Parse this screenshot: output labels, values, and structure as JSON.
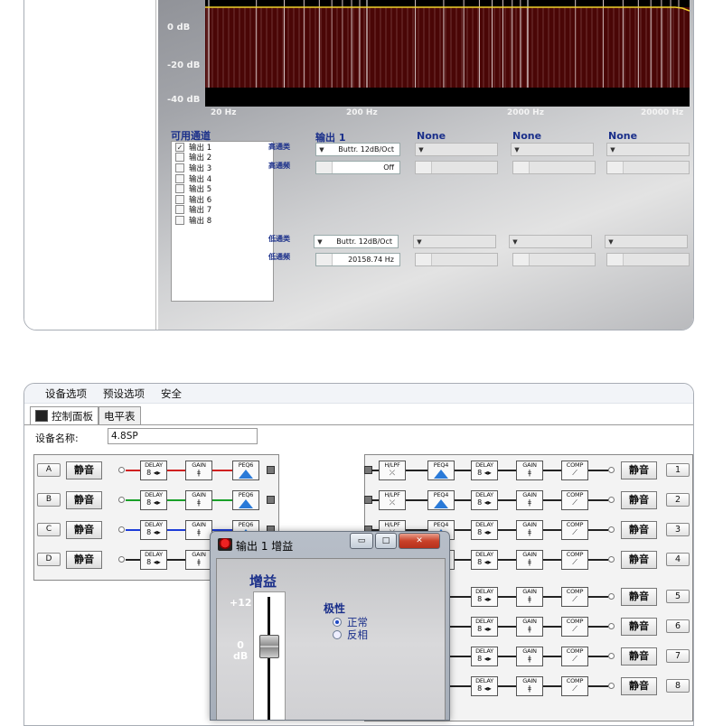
{
  "top_window": {
    "graph": {
      "db_labels": [
        "0 dB",
        "-20 dB",
        "-40 dB"
      ],
      "hz_labels": [
        "20 Hz",
        "200 Hz",
        "2000 Hz",
        "20000 Hz"
      ]
    },
    "channels_title": "可用通道",
    "channels": [
      {
        "label": "输出 1",
        "checked": true
      },
      {
        "label": "输出 2",
        "checked": false
      },
      {
        "label": "输出 3",
        "checked": false
      },
      {
        "label": "输出 4",
        "checked": false
      },
      {
        "label": "输出 5",
        "checked": false
      },
      {
        "label": "输出 6",
        "checked": false
      },
      {
        "label": "输出 7",
        "checked": false
      },
      {
        "label": "输出 8",
        "checked": false
      }
    ],
    "column_headers": [
      "输出 1",
      "None",
      "None",
      "None"
    ],
    "row_labels": {
      "hp_type": "高通类",
      "hp_freq": "高通频",
      "lp_type": "低通类",
      "lp_freq": "低通频"
    },
    "values": {
      "hp_type": "Buttr. 12dB/Oct",
      "hp_freq": "Off",
      "lp_type": "Buttr. 12dB/Oct",
      "lp_freq": "20158.74 Hz"
    }
  },
  "bottom_window": {
    "menu": [
      "设备选项",
      "预设选项",
      "安全"
    ],
    "tabs": [
      "控制面板",
      "电平表"
    ],
    "device_name_label": "设备名称:",
    "device_name_value": "4.8SP",
    "inputs": [
      {
        "id": "A",
        "mute": "静音",
        "color": "#d02020"
      },
      {
        "id": "B",
        "mute": "静音",
        "color": "#18a028"
      },
      {
        "id": "C",
        "mute": "静音",
        "color": "#1c3cd8"
      },
      {
        "id": "D",
        "mute": "静音",
        "color": "#222222"
      }
    ],
    "outputs": [
      {
        "id": "1",
        "mute": "静音"
      },
      {
        "id": "2",
        "mute": "静音"
      },
      {
        "id": "3",
        "mute": "静音"
      },
      {
        "id": "4",
        "mute": "静音"
      },
      {
        "id": "5",
        "mute": "静音"
      },
      {
        "id": "6",
        "mute": "静音"
      },
      {
        "id": "7",
        "mute": "静音"
      },
      {
        "id": "8",
        "mute": "静音"
      }
    ],
    "block_labels": {
      "delay": "DELAY",
      "gain": "GAIN",
      "peq6": "PEQ6",
      "peq4": "PEQ4",
      "hlpf": "H/LPF",
      "comp": "COMP"
    }
  },
  "gain_dialog": {
    "title": "输出 1  增益",
    "heading": "增益",
    "scale": [
      "+12",
      "0\ndB"
    ],
    "polarity_title": "极性",
    "polarity_options": [
      {
        "label": "正常",
        "selected": true
      },
      {
        "label": "反相",
        "selected": false
      }
    ]
  }
}
